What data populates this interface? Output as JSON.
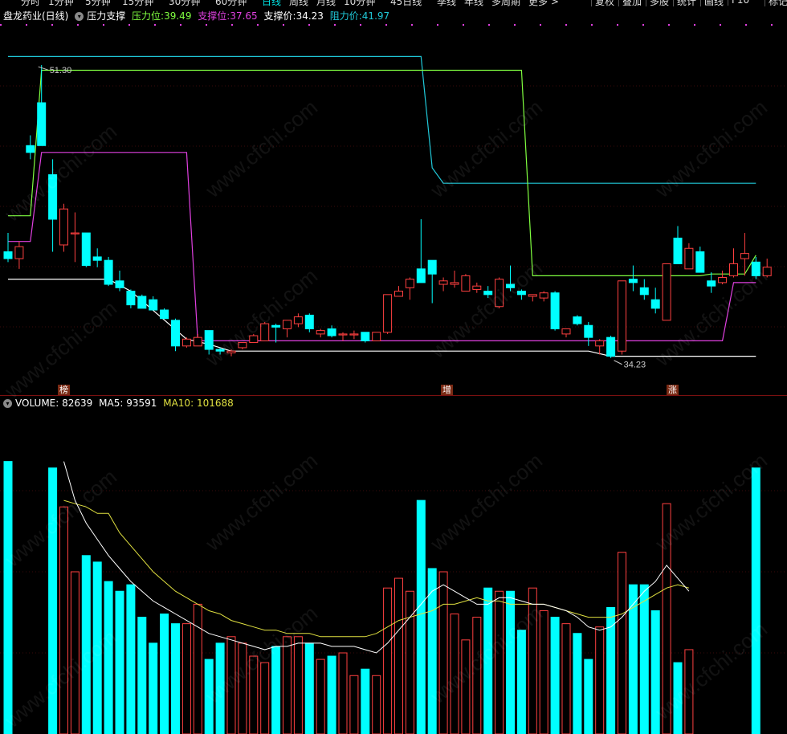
{
  "toolbar": {
    "tabs": [
      "分时",
      "1分钟",
      "5分钟",
      "15分钟",
      "30分钟",
      "60分钟",
      "日线",
      "周线",
      "月线",
      "10分钟",
      "45日线",
      "季线",
      "年线",
      "多周期",
      "更多 >"
    ],
    "active": "日线",
    "right_tabs": [
      "复权",
      "叠加",
      "多股",
      "统计",
      "画线",
      "F10",
      "标记"
    ]
  },
  "main_header": {
    "stock": "盘龙药业(日线)",
    "indicator": "压力支撑",
    "pressure_label": "压力位:",
    "pressure_value": "39.49",
    "support_label": "支撑位:",
    "support_value": "37.65",
    "support_price_label": "支撑价:",
    "support_price_value": "34.23",
    "resist_price_label": "阻力价:",
    "resist_price_value": "41.97"
  },
  "annotations": {
    "high": "51.30",
    "low": "34.23"
  },
  "tags": [
    "榜",
    "增",
    "涨"
  ],
  "volume_header": {
    "vol_label": "VOLUME:",
    "vol_value": "82639",
    "ma5_label": "MA5:",
    "ma5_value": "93591",
    "ma10_label": "MA10:",
    "ma10_value": "101688"
  },
  "watermark": "www.cfchi.com",
  "colors": {
    "up": "#ff4040",
    "down": "#00ffff",
    "pressure": "#80ff40",
    "support": "#e040e0",
    "support_price": "#ffffff",
    "resist_price": "#20c8d8",
    "ma5": "#ffffff",
    "ma10": "#e0e040"
  },
  "chart_data": {
    "type": "candlestick",
    "price_range": [
      32.5,
      53.6
    ],
    "candles": [
      {
        "o": 40.4,
        "h": 41.5,
        "l": 39.8,
        "c": 40.0
      },
      {
        "o": 40.0,
        "h": 41.0,
        "l": 39.4,
        "c": 40.7
      },
      {
        "o": 46.6,
        "h": 47.2,
        "l": 45.8,
        "c": 46.2
      },
      {
        "o": 49.1,
        "h": 51.3,
        "l": 46.8,
        "c": 46.6
      },
      {
        "o": 44.9,
        "h": 45.8,
        "l": 40.4,
        "c": 42.3
      },
      {
        "o": 40.8,
        "h": 43.2,
        "l": 40.4,
        "c": 42.9
      },
      {
        "o": 41.5,
        "h": 42.7,
        "l": 39.8,
        "c": 41.5
      },
      {
        "o": 41.5,
        "h": 41.5,
        "l": 39.5,
        "c": 39.6
      },
      {
        "o": 40.1,
        "h": 40.6,
        "l": 39.5,
        "c": 39.9
      },
      {
        "o": 39.9,
        "h": 40.1,
        "l": 38.4,
        "c": 38.5
      },
      {
        "o": 38.7,
        "h": 39.3,
        "l": 38.1,
        "c": 38.3
      },
      {
        "o": 38.1,
        "h": 38.2,
        "l": 37.1,
        "c": 37.3
      },
      {
        "o": 37.8,
        "h": 37.9,
        "l": 37.1,
        "c": 37.1
      },
      {
        "o": 37.6,
        "h": 37.8,
        "l": 37.0,
        "c": 37.0
      },
      {
        "o": 37.0,
        "h": 37.1,
        "l": 36.5,
        "c": 36.5
      },
      {
        "o": 36.4,
        "h": 36.5,
        "l": 34.6,
        "c": 34.9
      },
      {
        "o": 34.9,
        "h": 35.4,
        "l": 34.8,
        "c": 35.3
      },
      {
        "o": 34.9,
        "h": 35.6,
        "l": 34.9,
        "c": 35.4
      },
      {
        "o": 35.8,
        "h": 35.8,
        "l": 34.4,
        "c": 34.7
      },
      {
        "o": 34.7,
        "h": 34.8,
        "l": 34.4,
        "c": 34.6
      },
      {
        "o": 34.5,
        "h": 34.7,
        "l": 34.3,
        "c": 34.6
      },
      {
        "o": 34.8,
        "h": 35.1,
        "l": 34.7,
        "c": 35.1
      },
      {
        "o": 35.1,
        "h": 35.6,
        "l": 35.1,
        "c": 35.5
      },
      {
        "o": 35.2,
        "h": 36.3,
        "l": 35.2,
        "c": 36.2
      },
      {
        "o": 36.1,
        "h": 36.2,
        "l": 35.1,
        "c": 36.0
      },
      {
        "o": 35.9,
        "h": 36.4,
        "l": 35.4,
        "c": 36.4
      },
      {
        "o": 36.2,
        "h": 36.8,
        "l": 36.0,
        "c": 36.6
      },
      {
        "o": 36.7,
        "h": 36.8,
        "l": 35.7,
        "c": 35.9
      },
      {
        "o": 35.6,
        "h": 35.9,
        "l": 35.4,
        "c": 35.8
      },
      {
        "o": 35.9,
        "h": 36.1,
        "l": 35.4,
        "c": 35.5
      },
      {
        "o": 35.6,
        "h": 35.7,
        "l": 35.2,
        "c": 35.6
      },
      {
        "o": 35.6,
        "h": 35.8,
        "l": 35.3,
        "c": 35.6
      },
      {
        "o": 35.7,
        "h": 35.7,
        "l": 35.1,
        "c": 35.2
      },
      {
        "o": 35.2,
        "h": 35.7,
        "l": 35.2,
        "c": 35.7
      },
      {
        "o": 35.7,
        "h": 37.9,
        "l": 35.6,
        "c": 37.9
      },
      {
        "o": 37.8,
        "h": 38.4,
        "l": 37.8,
        "c": 38.1
      },
      {
        "o": 38.3,
        "h": 38.9,
        "l": 37.6,
        "c": 38.8
      },
      {
        "o": 39.4,
        "h": 42.3,
        "l": 38.6,
        "c": 38.6
      },
      {
        "o": 39.9,
        "h": 39.9,
        "l": 37.4,
        "c": 39.1
      },
      {
        "o": 38.5,
        "h": 38.9,
        "l": 38.1,
        "c": 38.7
      },
      {
        "o": 38.5,
        "h": 39.3,
        "l": 38.3,
        "c": 38.6
      },
      {
        "o": 38.1,
        "h": 39.1,
        "l": 38.1,
        "c": 39.0
      },
      {
        "o": 38.2,
        "h": 38.6,
        "l": 38.0,
        "c": 38.4
      },
      {
        "o": 38.1,
        "h": 38.4,
        "l": 37.7,
        "c": 37.9
      },
      {
        "o": 37.2,
        "h": 38.9,
        "l": 37.1,
        "c": 38.8
      },
      {
        "o": 38.5,
        "h": 39.6,
        "l": 38.1,
        "c": 38.3
      },
      {
        "o": 38.1,
        "h": 38.2,
        "l": 37.6,
        "c": 37.9
      },
      {
        "o": 37.8,
        "h": 37.9,
        "l": 37.5,
        "c": 37.9
      },
      {
        "o": 37.7,
        "h": 38.1,
        "l": 37.5,
        "c": 38.0
      },
      {
        "o": 38.0,
        "h": 38.1,
        "l": 35.8,
        "c": 35.9
      },
      {
        "o": 35.6,
        "h": 35.9,
        "l": 35.4,
        "c": 35.9
      },
      {
        "o": 36.6,
        "h": 36.7,
        "l": 36.1,
        "c": 36.2
      },
      {
        "o": 36.1,
        "h": 36.3,
        "l": 34.9,
        "c": 35.4
      },
      {
        "o": 34.9,
        "h": 35.3,
        "l": 34.4,
        "c": 35.2
      },
      {
        "o": 35.4,
        "h": 35.5,
        "l": 34.2,
        "c": 34.3
      },
      {
        "o": 34.6,
        "h": 38.7,
        "l": 34.4,
        "c": 38.7
      },
      {
        "o": 38.8,
        "h": 39.6,
        "l": 38.1,
        "c": 38.6
      },
      {
        "o": 38.3,
        "h": 38.8,
        "l": 37.6,
        "c": 37.9
      },
      {
        "o": 37.6,
        "h": 38.3,
        "l": 36.8,
        "c": 37.1
      },
      {
        "o": 36.4,
        "h": 39.7,
        "l": 36.4,
        "c": 39.7
      },
      {
        "o": 41.2,
        "h": 41.9,
        "l": 39.7,
        "c": 39.7
      },
      {
        "o": 39.4,
        "h": 40.9,
        "l": 39.4,
        "c": 40.6
      },
      {
        "o": 40.4,
        "h": 40.7,
        "l": 39.2,
        "c": 39.2
      },
      {
        "o": 38.7,
        "h": 39.2,
        "l": 38.0,
        "c": 38.4
      },
      {
        "o": 38.6,
        "h": 39.3,
        "l": 38.5,
        "c": 38.9
      },
      {
        "o": 39.0,
        "h": 40.6,
        "l": 38.9,
        "c": 39.7
      },
      {
        "o": 40.0,
        "h": 41.5,
        "l": 39.0,
        "c": 40.3
      },
      {
        "o": 39.8,
        "h": 40.1,
        "l": 38.8,
        "c": 39.0
      },
      {
        "o": 39.0,
        "h": 40.0,
        "l": 38.9,
        "c": 39.5
      }
    ],
    "pressure_line": [
      [
        0,
        42.5
      ],
      [
        1,
        42.5
      ],
      [
        2,
        42.5
      ],
      [
        3,
        51.0
      ],
      [
        4,
        51.0
      ],
      [
        5,
        51.0
      ],
      [
        6,
        51.0
      ],
      [
        7,
        51.0
      ],
      [
        8,
        51.0
      ],
      [
        9,
        51.0
      ],
      [
        10,
        51.0
      ],
      [
        11,
        51.0
      ],
      [
        12,
        51.0
      ],
      [
        13,
        51.0
      ],
      [
        14,
        51.0
      ],
      [
        15,
        51.0
      ],
      [
        16,
        51.0
      ],
      [
        17,
        51.0
      ],
      [
        18,
        51.0
      ],
      [
        19,
        51.0
      ],
      [
        20,
        51.0
      ],
      [
        21,
        51.0
      ],
      [
        22,
        51.0
      ],
      [
        23,
        51.0
      ],
      [
        24,
        51.0
      ],
      [
        25,
        51.0
      ],
      [
        26,
        51.0
      ],
      [
        27,
        51.0
      ],
      [
        28,
        51.0
      ],
      [
        29,
        51.0
      ],
      [
        30,
        51.0
      ],
      [
        31,
        51.0
      ],
      [
        32,
        51.0
      ],
      [
        33,
        51.0
      ],
      [
        34,
        51.0
      ],
      [
        35,
        51.0
      ],
      [
        36,
        51.0
      ],
      [
        37,
        51.0
      ],
      [
        38,
        51.0
      ],
      [
        39,
        51.0
      ],
      [
        40,
        51.0
      ],
      [
        41,
        51.0
      ],
      [
        42,
        51.0
      ],
      [
        43,
        51.0
      ],
      [
        44,
        51.0
      ],
      [
        45,
        51.0
      ],
      [
        46,
        51.0
      ],
      [
        47,
        39.0
      ],
      [
        48,
        39.0
      ],
      [
        49,
        39.0
      ],
      [
        50,
        39.0
      ],
      [
        51,
        39.0
      ],
      [
        52,
        39.0
      ],
      [
        53,
        39.0
      ],
      [
        54,
        39.0
      ],
      [
        55,
        39.0
      ],
      [
        56,
        39.0
      ],
      [
        57,
        39.0
      ],
      [
        58,
        39.0
      ],
      [
        59,
        39.0
      ],
      [
        60,
        39.0
      ],
      [
        61,
        39.0
      ],
      [
        62,
        39.0
      ],
      [
        63,
        39.1
      ],
      [
        64,
        39.1
      ],
      [
        65,
        39.1
      ],
      [
        66,
        39.1
      ],
      [
        67,
        40.2
      ]
    ],
    "support_line": [
      [
        0,
        41.0
      ],
      [
        1,
        41.0
      ],
      [
        2,
        41.0
      ],
      [
        3,
        46.2
      ],
      [
        4,
        46.2
      ],
      [
        5,
        46.2
      ],
      [
        6,
        46.2
      ],
      [
        7,
        46.2
      ],
      [
        8,
        46.2
      ],
      [
        9,
        46.2
      ],
      [
        10,
        46.2
      ],
      [
        11,
        46.2
      ],
      [
        12,
        46.2
      ],
      [
        13,
        46.2
      ],
      [
        14,
        46.2
      ],
      [
        15,
        46.2
      ],
      [
        16,
        46.2
      ],
      [
        17,
        35.2
      ],
      [
        18,
        35.2
      ],
      [
        19,
        35.2
      ],
      [
        20,
        35.2
      ],
      [
        21,
        35.2
      ],
      [
        22,
        35.2
      ],
      [
        23,
        35.2
      ],
      [
        24,
        35.2
      ],
      [
        25,
        35.2
      ],
      [
        26,
        35.2
      ],
      [
        27,
        35.2
      ],
      [
        28,
        35.2
      ],
      [
        29,
        35.2
      ],
      [
        30,
        35.2
      ],
      [
        31,
        35.2
      ],
      [
        32,
        35.2
      ],
      [
        33,
        35.2
      ],
      [
        34,
        35.2
      ],
      [
        35,
        35.2
      ],
      [
        36,
        35.2
      ],
      [
        37,
        35.2
      ],
      [
        38,
        35.2
      ],
      [
        39,
        35.2
      ],
      [
        40,
        35.2
      ],
      [
        41,
        35.2
      ],
      [
        42,
        35.2
      ],
      [
        43,
        35.2
      ],
      [
        44,
        35.2
      ],
      [
        45,
        35.2
      ],
      [
        46,
        35.2
      ],
      [
        47,
        35.2
      ],
      [
        48,
        35.2
      ],
      [
        49,
        35.2
      ],
      [
        50,
        35.2
      ],
      [
        51,
        35.2
      ],
      [
        52,
        35.2
      ],
      [
        53,
        35.2
      ],
      [
        54,
        35.2
      ],
      [
        55,
        35.2
      ],
      [
        56,
        35.2
      ],
      [
        57,
        35.2
      ],
      [
        58,
        35.2
      ],
      [
        59,
        35.2
      ],
      [
        60,
        35.2
      ],
      [
        61,
        35.2
      ],
      [
        62,
        35.2
      ],
      [
        63,
        35.2
      ],
      [
        64,
        35.2
      ],
      [
        65,
        38.6
      ],
      [
        66,
        38.6
      ],
      [
        67,
        38.6
      ]
    ],
    "support_price_line": [
      [
        0,
        38.8
      ],
      [
        9,
        38.8
      ],
      [
        11,
        38.1
      ],
      [
        16,
        35.3
      ],
      [
        18,
        35.0
      ],
      [
        20,
        34.6
      ],
      [
        52,
        34.6
      ],
      [
        54,
        34.3
      ],
      [
        67,
        34.3
      ]
    ],
    "resist_price_line": [
      [
        0,
        51.8
      ],
      [
        1,
        51.8
      ],
      [
        2,
        51.8
      ],
      [
        3,
        51.8
      ],
      [
        4,
        51.8
      ],
      [
        5,
        51.8
      ],
      [
        6,
        51.8
      ],
      [
        7,
        51.8
      ],
      [
        37,
        51.8
      ],
      [
        38,
        45.3
      ],
      [
        39,
        44.4
      ],
      [
        67,
        44.4
      ]
    ],
    "volume": [
      84,
      0,
      0,
      0,
      82,
      70,
      50,
      55,
      53,
      47,
      44,
      46,
      36,
      28,
      37,
      34,
      34,
      40,
      23,
      28,
      30,
      28,
      24,
      22,
      27,
      30,
      30,
      28,
      23,
      24,
      25,
      18,
      20,
      18,
      45,
      48,
      44,
      72,
      51,
      50,
      37,
      29,
      36,
      45,
      44,
      44,
      32,
      45,
      38,
      36,
      34,
      31,
      23,
      33,
      39,
      56,
      46,
      46,
      38,
      71,
      22,
      26,
      0,
      0,
      0,
      0,
      0,
      82
    ],
    "ma5": [
      78,
      0,
      0,
      0,
      0,
      84,
      72,
      65,
      60,
      55,
      51,
      47,
      44,
      41,
      39,
      37,
      35,
      33,
      31,
      30,
      29,
      28,
      27,
      26,
      27,
      27,
      28,
      28,
      28,
      27,
      27,
      27,
      26,
      25,
      28,
      32,
      36,
      40,
      44,
      46,
      44,
      42,
      40,
      40,
      42,
      42,
      41,
      40,
      40,
      39,
      38,
      36,
      33,
      32,
      33,
      36,
      40,
      44,
      47,
      52,
      48,
      44,
      0,
      0,
      0,
      0,
      0,
      80
    ],
    "ma10": [
      72,
      0,
      0,
      0,
      0,
      72,
      71,
      70,
      68,
      68,
      62,
      58,
      54,
      50,
      47,
      44,
      42,
      40,
      38,
      37,
      35,
      34,
      33,
      32,
      32,
      31,
      31,
      31,
      30,
      30,
      30,
      30,
      30,
      31,
      33,
      35,
      36,
      37,
      38,
      40,
      40,
      41,
      42,
      41,
      41,
      40,
      40,
      40,
      40,
      39,
      38,
      37,
      36,
      36,
      36,
      37,
      39,
      41,
      43,
      45,
      46,
      45,
      0,
      0,
      0,
      0,
      0,
      83
    ],
    "volume_range": [
      0,
      100
    ]
  }
}
